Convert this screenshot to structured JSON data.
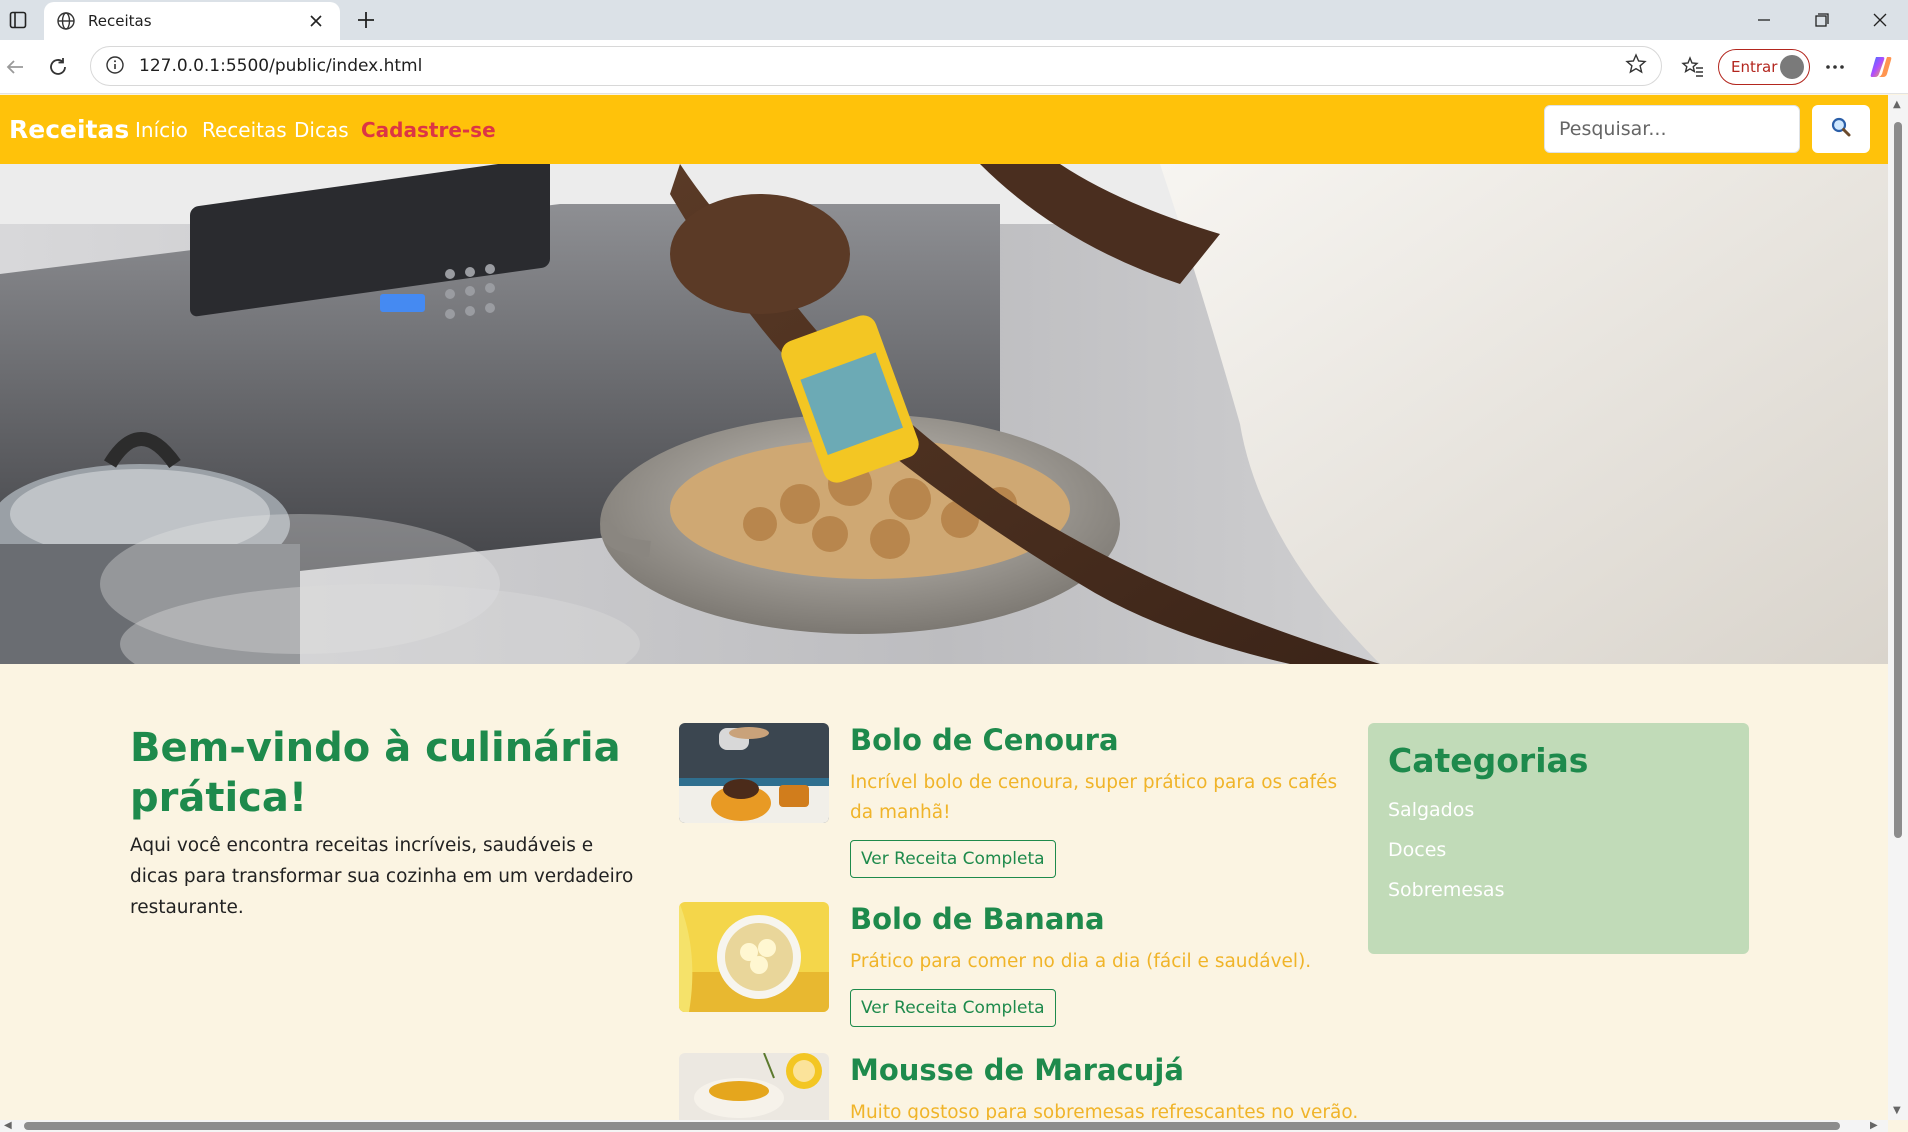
{
  "browser": {
    "tab_title": "Receitas",
    "url": "127.0.0.1:5500/public/index.html",
    "signin_label": "Entrar"
  },
  "site": {
    "brand": "Receitas",
    "nav": [
      "Início",
      "Receitas",
      "Dicas",
      "Cadastre-se"
    ],
    "search_placeholder": "Pesquisar..."
  },
  "welcome": {
    "title": "Bem-vindo à culinária prática!",
    "text": "Aqui você encontra receitas incríveis, saudáveis e dicas para transformar sua cozinha em um verdadeiro restaurante."
  },
  "recipes": [
    {
      "title": "Bolo de Cenoura",
      "description": "Incrível bolo de cenoura, super prático para os cafés da manhã!",
      "button": "Ver Receita Completa"
    },
    {
      "title": "Bolo de Banana",
      "description": "Prático para comer no dia a dia (fácil e saudável).",
      "button": "Ver Receita Completa"
    },
    {
      "title": "Mousse de Maracujá",
      "description": "Muito gostoso para sobremesas refrescantes no verão."
    }
  ],
  "categories": {
    "title": "Categorias",
    "items": [
      "Salgados",
      "Doces",
      "Sobremesas"
    ]
  },
  "colors": {
    "navbar": "#ffc20a",
    "accent_green": "#1e8a4c",
    "description_yellow": "#f0b429",
    "signup_red": "#dc3545",
    "page_bg": "#fbf4e2",
    "categories_bg": "#c1dbb8"
  },
  "icons": [
    "sidebar-toggle-icon",
    "globe-icon",
    "close-icon",
    "new-tab-icon",
    "minimize-icon",
    "maximize-icon",
    "window-close-icon",
    "back-icon",
    "reload-icon",
    "site-info-icon",
    "bookmark-star-icon",
    "favorites-icon",
    "profile-avatar-icon",
    "more-options-icon",
    "copilot-icon",
    "search-icon"
  ]
}
